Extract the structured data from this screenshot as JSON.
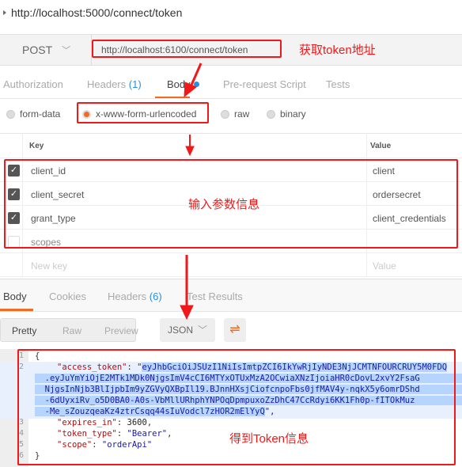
{
  "window_title": "http://localhost:5000/connect/token",
  "request": {
    "method": "POST",
    "url": "http://localhost:6100/connect/token",
    "annotation": "获取token地址"
  },
  "req_tabs": {
    "authorization": "Authorization",
    "headers": "Headers",
    "headers_count": "(1)",
    "body": "Body",
    "prerequest": "Pre-request Script",
    "tests": "Tests"
  },
  "body_modes": {
    "form_data": "form-data",
    "urlencoded": "x-www-form-urlencoded",
    "raw": "raw",
    "binary": "binary",
    "selected": "x-www-form-urlencoded"
  },
  "params": {
    "key_header": "Key",
    "value_header": "Value",
    "annotation": "输入参数信息",
    "rows": [
      {
        "key": "client_id",
        "value": "client",
        "checked": true
      },
      {
        "key": "client_secret",
        "value": "ordersecret",
        "checked": true
      },
      {
        "key": "grant_type",
        "value": "client_credentials",
        "checked": true
      },
      {
        "key": "scopes",
        "value": "",
        "checked": false
      }
    ],
    "new_key_placeholder": "New key",
    "new_value_placeholder": "Value"
  },
  "resp_tabs": {
    "body": "Body",
    "cookies": "Cookies",
    "headers": "Headers",
    "headers_count": "(6)",
    "test_results": "Test Results"
  },
  "resp_toolbar": {
    "pretty": "Pretty",
    "raw": "Raw",
    "preview": "Preview",
    "format": "JSON"
  },
  "response": {
    "annotation": "得到Token信息",
    "line_numbers": [
      "1",
      "2",
      "3",
      "4",
      "5",
      "6"
    ],
    "open": "{",
    "close": "}",
    "k_access": "\"access_token\"",
    "token_lines": [
      "eyJhbGciOiJSUzI1NiIsImtpZCI6IkYwRjIyNDE3NjJCMTNFOURCRUY5M0FDQ",
      "  .eyJuYmYiOjE2MTk1MDk0NjgsImV4cCI6MTYxOTUxMzA2OCwiaXNzIjoiaHR0cDovL2xvY2FsaG",
      "  NjgsInNjb3BlIjpbIm9yZGVyQXBpIl19.BJnnHXsjCiofcnpoFbs0jfMAV4y-nqkX5y6omrDShd",
      "  -6dUyxiRv_o5D0BA0-A0s-VbMllURhphYNPOqDpmpuxoZzDhC47CcRdyi6KK1Fh0p-fITOkMuz",
      "  -Me_sZouzqeaKz4ztrCsqq44sIuVodcl7zHOR2mElYyQ"
    ],
    "k_expires": "\"expires_in\"",
    "v_expires": "3600",
    "k_type": "\"token_type\"",
    "v_type": "\"Bearer\"",
    "k_scope": "\"scope\"",
    "v_scope": "\"orderApi\""
  },
  "colors": {
    "accent": "#f26b21",
    "annotation": "#f01818",
    "link": "#2a8fe0"
  }
}
